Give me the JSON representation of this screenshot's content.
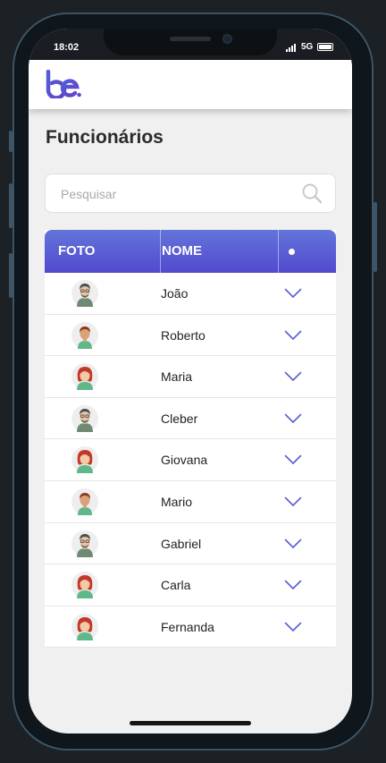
{
  "status": {
    "time": "18:02",
    "network": "5G"
  },
  "app": {
    "logo_text": "be."
  },
  "page": {
    "title": "Funcionários"
  },
  "search": {
    "placeholder": "Pesquisar"
  },
  "table": {
    "headers": {
      "photo": "FOTO",
      "name": "NOME"
    },
    "rows": [
      {
        "name": "João",
        "avatar": "older-man"
      },
      {
        "name": "Roberto",
        "avatar": "young-man"
      },
      {
        "name": "Maria",
        "avatar": "woman"
      },
      {
        "name": "Cleber",
        "avatar": "older-man"
      },
      {
        "name": "Giovana",
        "avatar": "woman"
      },
      {
        "name": "Mario",
        "avatar": "young-man"
      },
      {
        "name": "Gabriel",
        "avatar": "older-man"
      },
      {
        "name": "Carla",
        "avatar": "woman"
      },
      {
        "name": "Fernanda",
        "avatar": "woman"
      }
    ]
  },
  "colors": {
    "header_gradient_top": "#6375d9",
    "header_gradient_bottom": "#5249cf",
    "chevron": "#5a5fd0",
    "logo_gradient_start": "#4f5fd8",
    "logo_gradient_end": "#6a3fc6"
  }
}
